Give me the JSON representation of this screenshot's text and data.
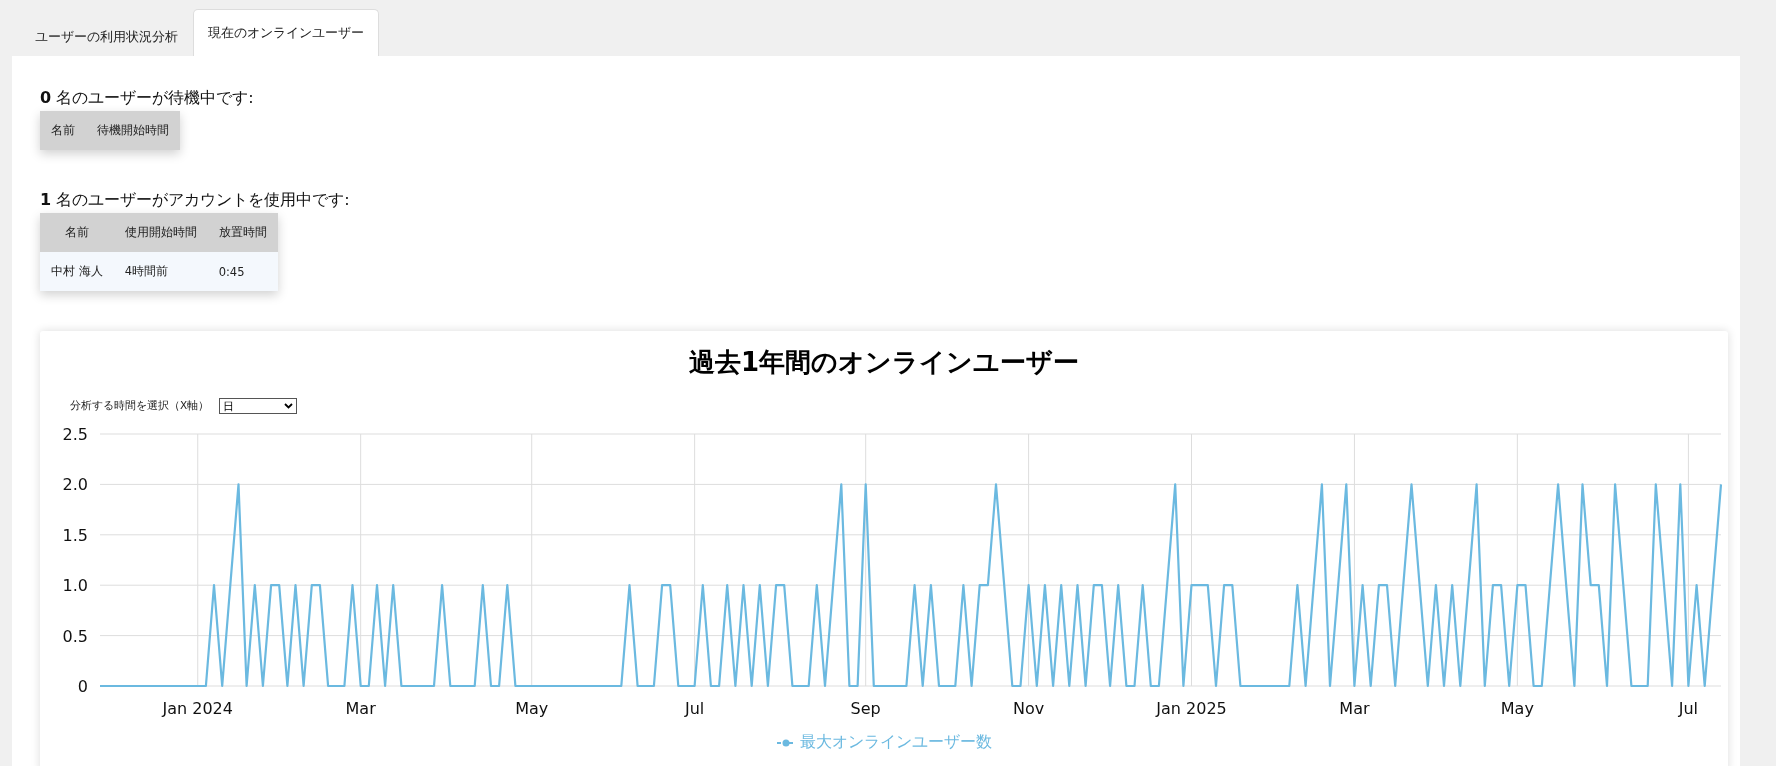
{
  "tabs": [
    {
      "label": "ユーザーの利用状況分析",
      "selected": false
    },
    {
      "label": "現在のオンラインユーザー",
      "selected": true
    }
  ],
  "waiting": {
    "heading": "**0** 名のユーザーが待機中です:",
    "columns": [
      "名前",
      "待機開始時間"
    ]
  },
  "active": {
    "heading": "**1** 名のユーザーがアカウントを使用中です:",
    "columns": [
      "名前",
      "使用開始時間",
      "放置時間"
    ],
    "rows": [
      [
        "中村 海人",
        "4時間前",
        "0:45"
      ]
    ]
  },
  "chart_card": {
    "title": "過去1年間のオンラインユーザー",
    "select_label": "分析する時間を選択（X軸）",
    "select_value": "日",
    "chart_data": {
      "type": "line",
      "grid": true,
      "ylim": [
        0,
        2.5
      ],
      "yticks": [
        {
          "value": 0,
          "label": "0"
        },
        {
          "value": 0.5,
          "label": "0.5"
        },
        {
          "value": 1,
          "label": "1.0"
        },
        {
          "value": 1.5,
          "label": "1.5"
        },
        {
          "value": 2,
          "label": "2.0"
        },
        {
          "value": 2.5,
          "label": "2.5"
        }
      ],
      "categories": [
        null,
        null,
        null,
        null,
        null,
        null,
        null,
        null,
        null,
        null,
        null,
        null,
        "Jan 2024",
        null,
        null,
        null,
        null,
        null,
        null,
        null,
        null,
        null,
        null,
        null,
        null,
        null,
        null,
        null,
        null,
        null,
        null,
        null,
        "Mar",
        null,
        null,
        null,
        null,
        null,
        null,
        null,
        null,
        null,
        null,
        null,
        null,
        null,
        null,
        null,
        null,
        null,
        null,
        null,
        null,
        "May",
        null,
        null,
        null,
        null,
        null,
        null,
        null,
        null,
        null,
        null,
        null,
        null,
        null,
        null,
        null,
        null,
        null,
        null,
        null,
        "Jul",
        null,
        null,
        null,
        null,
        null,
        null,
        null,
        null,
        null,
        null,
        null,
        null,
        null,
        null,
        null,
        null,
        null,
        null,
        null,
        null,
        "Sep",
        null,
        null,
        null,
        null,
        null,
        null,
        null,
        null,
        null,
        null,
        null,
        null,
        null,
        null,
        null,
        null,
        null,
        null,
        null,
        "Nov",
        null,
        null,
        null,
        null,
        null,
        null,
        null,
        null,
        null,
        null,
        null,
        null,
        null,
        null,
        null,
        null,
        null,
        null,
        null,
        "Jan 2025",
        null,
        null,
        null,
        null,
        null,
        null,
        null,
        null,
        null,
        null,
        null,
        null,
        null,
        null,
        null,
        null,
        null,
        null,
        null,
        "Mar",
        null,
        null,
        null,
        null,
        null,
        null,
        null,
        null,
        null,
        null,
        null,
        null,
        null,
        null,
        null,
        null,
        null,
        null,
        null,
        "May",
        null,
        null,
        null,
        null,
        null,
        null,
        null,
        null,
        null,
        null,
        null,
        null,
        null,
        null,
        null,
        null,
        null,
        null,
        null,
        null,
        "Jul",
        null,
        null,
        null,
        null
      ],
      "series": [
        {
          "name": "最大オンラインユーザー数",
          "color": "#6bb9e0",
          "values": [
            0,
            0,
            0,
            0,
            0,
            0,
            0,
            0,
            0,
            0,
            0,
            0,
            0,
            0,
            1,
            0,
            1,
            2,
            0,
            1,
            0,
            1,
            1,
            0,
            1,
            0,
            1,
            1,
            0,
            0,
            0,
            1,
            0,
            0,
            1,
            0,
            1,
            0,
            0,
            0,
            0,
            0,
            1,
            0,
            0,
            0,
            0,
            1,
            0,
            0,
            1,
            0,
            0,
            0,
            0,
            0,
            0,
            0,
            0,
            0,
            0,
            0,
            0,
            0,
            0,
            1,
            0,
            0,
            0,
            1,
            1,
            0,
            0,
            0,
            1,
            0,
            0,
            1,
            0,
            1,
            0,
            1,
            0,
            1,
            1,
            0,
            0,
            0,
            1,
            0,
            1,
            2,
            0,
            0,
            2,
            0,
            0,
            0,
            0,
            0,
            1,
            0,
            1,
            0,
            0,
            0,
            1,
            0,
            1,
            1,
            2,
            1,
            0,
            0,
            1,
            0,
            1,
            0,
            1,
            0,
            1,
            0,
            1,
            1,
            0,
            1,
            0,
            0,
            1,
            0,
            0,
            1,
            2,
            0,
            1,
            1,
            1,
            0,
            1,
            1,
            0,
            0,
            0,
            0,
            0,
            0,
            0,
            1,
            0,
            1,
            2,
            0,
            1,
            2,
            0,
            1,
            0,
            1,
            1,
            0,
            1,
            2,
            1,
            0,
            1,
            0,
            1,
            0,
            1,
            2,
            0,
            1,
            1,
            0,
            1,
            1,
            0,
            0,
            1,
            2,
            1,
            0,
            2,
            1,
            1,
            0,
            2,
            1,
            0,
            0,
            0,
            2,
            1,
            0,
            2,
            0,
            1,
            0,
            1,
            2
          ]
        }
      ]
    }
  }
}
